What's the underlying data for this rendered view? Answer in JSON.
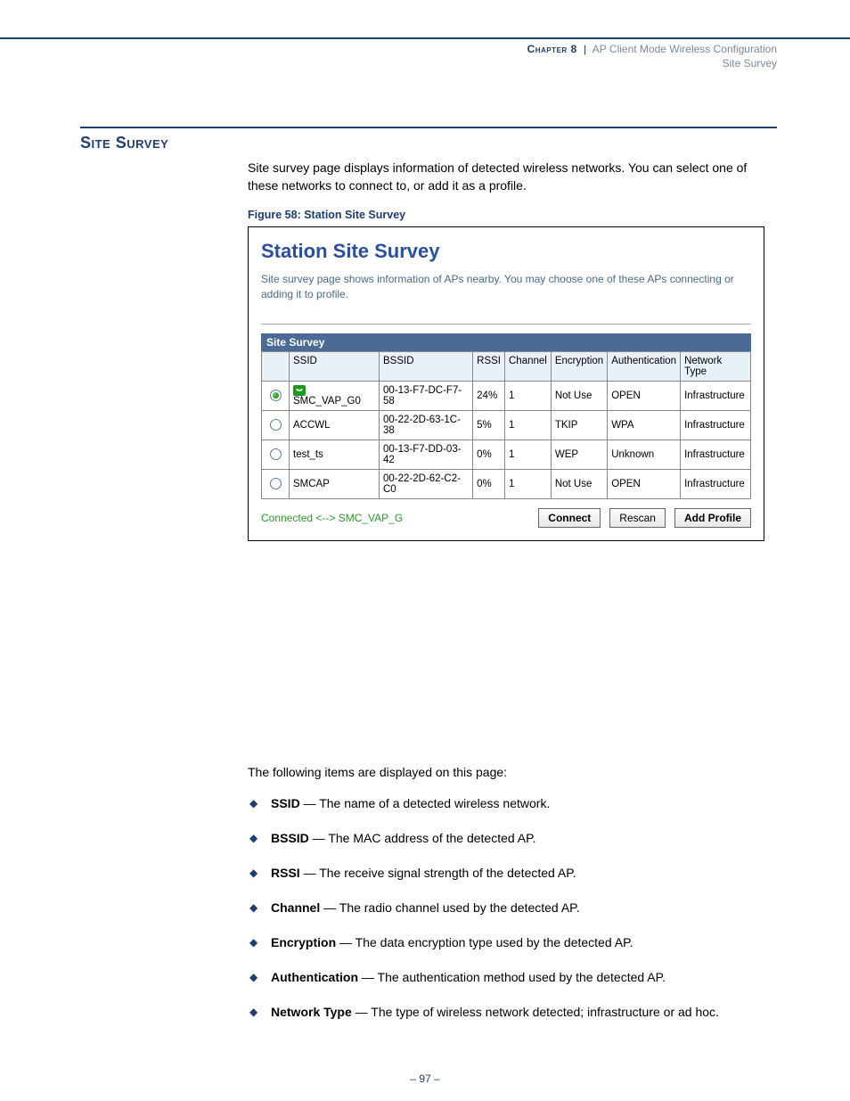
{
  "header": {
    "chapter": "Chapter 8",
    "separator": "|",
    "chapter_title": "AP Client Mode Wireless Configuration",
    "subtitle": "Site Survey"
  },
  "section_title": "Site Survey",
  "intro": "Site survey page displays information of detected wireless networks. You can select one of these networks to connect to, or add it as a profile.",
  "figure": {
    "caption": "Figure 58:  Station Site Survey",
    "panel_title": "Station Site Survey",
    "panel_desc": "Site survey page shows information of APs nearby. You may choose one of these APs connecting or adding it to profile.",
    "table_title": "Site Survey",
    "columns": {
      "c0": "",
      "c1": "SSID",
      "c2": "BSSID",
      "c3": "RSSI",
      "c4": "Channel",
      "c5": "Encryption",
      "c6": "Authentication",
      "c7": "Network Type"
    },
    "rows": [
      {
        "selected": true,
        "connected": true,
        "ssid": "SMC_VAP_G0",
        "bssid": "00-13-F7-DC-F7-58",
        "rssi": "24%",
        "channel": "1",
        "encryption": "Not Use",
        "auth": "OPEN",
        "ntype": "Infrastructure"
      },
      {
        "selected": false,
        "connected": false,
        "ssid": "ACCWL",
        "bssid": "00-22-2D-63-1C-38",
        "rssi": "5%",
        "channel": "1",
        "encryption": "TKIP",
        "auth": "WPA",
        "ntype": "Infrastructure"
      },
      {
        "selected": false,
        "connected": false,
        "ssid": "test_ts",
        "bssid": "00-13-F7-DD-03-42",
        "rssi": "0%",
        "channel": "1",
        "encryption": "WEP",
        "auth": "Unknown",
        "ntype": "Infrastructure"
      },
      {
        "selected": false,
        "connected": false,
        "ssid": "SMCAP",
        "bssid": "00-22-2D-62-C2-C0",
        "rssi": "0%",
        "channel": "1",
        "encryption": "Not Use",
        "auth": "OPEN",
        "ntype": "Infrastructure"
      }
    ],
    "status": "Connected <--> SMC_VAP_G",
    "buttons": {
      "connect": "Connect",
      "rescan": "Rescan",
      "add_profile": "Add Profile"
    }
  },
  "post_intro": "The following items are displayed on this page:",
  "definitions": [
    {
      "term": "SSID",
      "desc": " — The name of a detected wireless network."
    },
    {
      "term": "BSSID",
      "desc": " — The MAC address of the detected AP."
    },
    {
      "term": "RSSI",
      "desc": " — The receive signal strength of the detected AP."
    },
    {
      "term": "Channel",
      "desc": " — The radio channel used by the detected AP."
    },
    {
      "term": "Encryption",
      "desc": " — The data encryption type used by the detected AP."
    },
    {
      "term": "Authentication",
      "desc": " — The authentication method used by the detected AP."
    },
    {
      "term": "Network Type",
      "desc": " — The type of wireless network detected; infrastructure or ad hoc."
    }
  ],
  "page_number": "–  97  –"
}
